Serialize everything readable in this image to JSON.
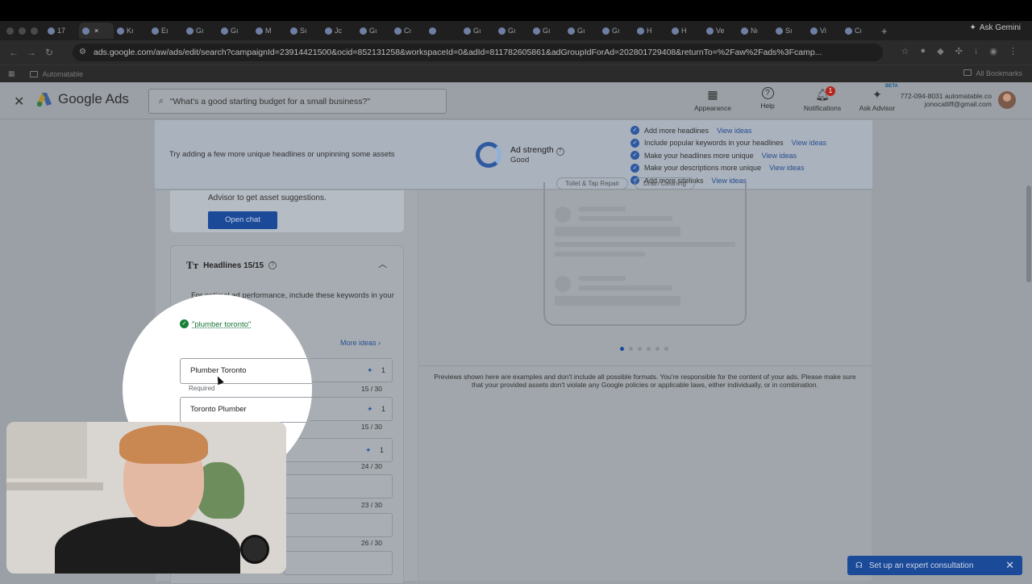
{
  "browser": {
    "tabs": [
      "17",
      "",
      "Kı",
      "Eı",
      "Gı",
      "Gı",
      "M",
      "Sı",
      "Jc",
      "Gı",
      "Cı",
      "",
      "Gı",
      "Gı",
      "Gı",
      "Gı",
      "Gı",
      "H",
      "H",
      "Ve",
      "Nı",
      "Sı",
      "Vi",
      "Cı"
    ],
    "ask_gemini": "Ask Gemini",
    "url": "ads.google.com/aw/ads/edit/search?campaignId=23914421500&ocid=852131258&workspaceId=0&adId=811782605861&adGroupIdForAd=202801729408&returnTo=%2Faw%2Fads%3Fcamp...",
    "bookmark_folder": "Automatable",
    "all_bookmarks": "All Bookmarks"
  },
  "header": {
    "close": "✕",
    "brand": "Google Ads",
    "search_placeholder": "\"What's a good starting budget for a small business?\"",
    "tools": [
      {
        "label": "Appearance",
        "icon": "▦"
      },
      {
        "label": "Help",
        "icon": "?"
      },
      {
        "label": "Notifications",
        "icon": "🔔",
        "badge": "1"
      },
      {
        "label": "Ask Advisor",
        "icon": "✦",
        "beta": "BETA"
      }
    ],
    "account_phone": "772-094-8031 automatable.co",
    "account_email": "jonocatliff@gmail.com"
  },
  "ad_strength": {
    "tip": "Try adding a few more unique headlines or unpinning some assets",
    "label": "Ad strength",
    "value": "Good",
    "suggestions": [
      {
        "text": "Add more headlines",
        "link": "View ideas"
      },
      {
        "text": "Include popular keywords in your headlines",
        "link": "View ideas"
      },
      {
        "text": "Make your headlines more unique",
        "link": "View ideas"
      },
      {
        "text": "Make your descriptions more unique",
        "link": "View ideas"
      },
      {
        "text": "Add more sitelinks",
        "link": "View ideas"
      }
    ]
  },
  "advisor": {
    "text": "Advisor to get asset suggestions.",
    "button": "Open chat"
  },
  "headlines": {
    "title": "Headlines 15/15",
    "note": "For optimal ad performance, include these keywords in your headlines",
    "keyword": "\"plumber toronto\"",
    "more_ideas": "More ideas",
    "required": "Required",
    "rows": [
      {
        "text": "Plumber Toronto",
        "pin": "1",
        "count": "15 / 30"
      },
      {
        "text": "Toronto Plumber",
        "pin": "1",
        "count": "15 / 30"
      },
      {
        "text": "",
        "pin": "1",
        "count": "24 / 30"
      },
      {
        "text": "",
        "pin": "",
        "count": "23 / 30"
      },
      {
        "text": "",
        "pin": "",
        "count": "26 / 30"
      },
      {
        "text": "",
        "pin": "",
        "count": ""
      }
    ]
  },
  "preview": {
    "chips": [
      "Toilet & Tap Repair",
      "Drain Cleaning"
    ],
    "disclaimer": "Previews shown here are examples and don't include all possible formats. You're responsible for the content of your ads. Please make sure that your provided assets don't violate any Google policies or applicable laws, either individually, or in combination."
  },
  "consultation": {
    "label": "Set up an expert consultation"
  },
  "colors": {
    "brand_blue": "#1b4a99",
    "check_green": "#188038"
  }
}
